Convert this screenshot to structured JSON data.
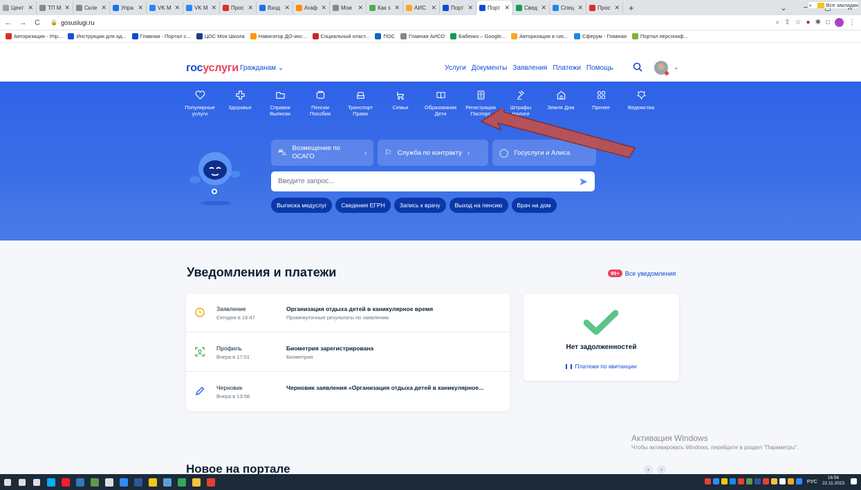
{
  "browser": {
    "tabs": [
      {
        "label": "Цент",
        "color": "#9aa0a6"
      },
      {
        "label": "ТП М",
        "color": "#888888"
      },
      {
        "label": "Скле",
        "color": "#888888"
      },
      {
        "label": "Упра",
        "color": "#1a73e8"
      },
      {
        "label": "VK М",
        "color": "#2787f5"
      },
      {
        "label": "VK М",
        "color": "#2787f5"
      },
      {
        "label": "Прос",
        "color": "#d93025"
      },
      {
        "label": "Вход",
        "color": "#1a73e8"
      },
      {
        "label": "Агаф",
        "color": "#ff8c00"
      },
      {
        "label": "Мои",
        "color": "#888888"
      },
      {
        "label": "Как з",
        "color": "#4caf50"
      },
      {
        "label": "АИС",
        "color": "#f9a825"
      },
      {
        "label": "Порт",
        "color": "#0d4cd3"
      },
      {
        "label": "Порт",
        "color": "#0d4cd3",
        "active": true
      },
      {
        "label": "Свед",
        "color": "#0f9d58"
      },
      {
        "label": "Спец",
        "color": "#1e88e5"
      },
      {
        "label": "Прос",
        "color": "#d93025"
      }
    ],
    "new_tab": "+",
    "url": "gosuslugi.ru",
    "bookmarks": [
      {
        "label": "Авторизация - Упр...",
        "color": "#d93025"
      },
      {
        "label": "Инструкции для ад...",
        "color": "#1a4fd8"
      },
      {
        "label": "Главная - Портал с...",
        "color": "#0d4cd3"
      },
      {
        "label": "ЦОС Моя Школа",
        "color": "#1e3a8a"
      },
      {
        "label": "Навигатор ДО-инс...",
        "color": "#ff9800"
      },
      {
        "label": "Социальный класт...",
        "color": "#c62828"
      },
      {
        "label": "ПОС",
        "color": "#1565c0"
      },
      {
        "label": "Главная АИСО",
        "color": "#888888"
      },
      {
        "label": "Бабенко – Google...",
        "color": "#0f9d58"
      },
      {
        "label": "Авторизация в сис...",
        "color": "#f9a825"
      },
      {
        "label": "Сферум - Главная",
        "color": "#1e88e5"
      },
      {
        "label": "Портал персониф...",
        "color": "#7cb342"
      }
    ],
    "bookmarks_more": "»",
    "all_bookmarks": "Все закладки"
  },
  "header": {
    "logo_part1": "гос",
    "logo_part2": "услуги",
    "audience": "Гражданам",
    "nav": [
      "Услуги",
      "Документы",
      "Заявления",
      "Платежи",
      "Помощь"
    ]
  },
  "categories": [
    {
      "label": "Популярные услуги",
      "icon": "heart-icon"
    },
    {
      "label": "Здоровье",
      "icon": "medical-cross-icon"
    },
    {
      "label": "Справки Выписки",
      "icon": "folder-icon"
    },
    {
      "label": "Пенсии Пособия",
      "icon": "wallet-icon"
    },
    {
      "label": "Транспорт Права",
      "icon": "car-icon"
    },
    {
      "label": "Семья",
      "icon": "stroller-icon"
    },
    {
      "label": "Образование Дети",
      "icon": "book-icon"
    },
    {
      "label": "Регистрация Паспорт",
      "icon": "passport-icon"
    },
    {
      "label": "Штрафы Налоги",
      "icon": "gavel-icon"
    },
    {
      "label": "Земля Дом",
      "icon": "house-icon"
    },
    {
      "label": "Прочее",
      "icon": "grid-icon"
    },
    {
      "label": "Ведомства",
      "icon": "emblem-icon"
    }
  ],
  "promos": [
    {
      "label": "Возмещение по ОСАГО",
      "icon": "car-outline-icon"
    },
    {
      "label": "Служба по контракту",
      "icon": "flag-icon"
    },
    {
      "label": "Госуслуги и Алиса",
      "icon": "alice-icon"
    }
  ],
  "search": {
    "placeholder": "Введите запрос..."
  },
  "quick_chips": [
    "Выписка медуслуг",
    "Сведения ЕГРН",
    "Запись к врачу",
    "Выход на пенсию",
    "Врач на дом"
  ],
  "notifications": {
    "title": "Уведомления и платежи",
    "badge": "99+",
    "all_link": "Все уведомления",
    "items": [
      {
        "type": "Заявление",
        "time": "Сегодня в 16:47",
        "title": "Организация отдыха детей в каникулярное время",
        "subtitle": "Промежуточные результаты по заявлению",
        "icon": "clock-icon"
      },
      {
        "type": "Профиль",
        "time": "Вчера в 17:01",
        "title": "Биометрия зарегистрирована",
        "subtitle": "Биометрия",
        "icon": "biometry-icon"
      },
      {
        "type": "Черновик",
        "time": "Вчера в 13:58",
        "title": "Черновик заявления «Организация отдыха детей в каникулярное...",
        "subtitle": "",
        "icon": "pencil-icon"
      }
    ]
  },
  "debt": {
    "title": "Нет задолженностей",
    "link": "Платежи по квитанции"
  },
  "activation": {
    "line1": "Активация Windows",
    "line2": "Чтобы активировать Windows, перейдите в раздел \"Параметры\"."
  },
  "new_on_portal": "Новое на портале",
  "taskbar": {
    "lang": "РУС",
    "time": "16:56",
    "date": "22.11.2023",
    "apps": [
      {
        "icon": "windows-start-icon",
        "color": "#ffffff"
      },
      {
        "icon": "search-icon",
        "color": "#ffffff"
      },
      {
        "icon": "task-view-icon",
        "color": "#ffffff"
      },
      {
        "icon": "skype-icon",
        "color": "#00aff0"
      },
      {
        "icon": "opera-icon",
        "color": "#ff1b2d"
      },
      {
        "icon": "edge-icon",
        "color": "#3277bc"
      },
      {
        "icon": "app-icon",
        "color": "#5c9a4a"
      },
      {
        "icon": "pen-app-icon",
        "color": "#dddddd"
      },
      {
        "icon": "zoom-icon",
        "color": "#2d8cff"
      },
      {
        "icon": "word-icon",
        "color": "#2b579a"
      },
      {
        "icon": "image-app-icon",
        "color": "#f2c811"
      },
      {
        "icon": "app2-icon",
        "color": "#5aa0d8"
      },
      {
        "icon": "chrome-icon",
        "color": "#34a853"
      },
      {
        "icon": "explorer-icon",
        "color": "#f9c23c"
      },
      {
        "icon": "chrome-profile-icon",
        "color": "#e34133"
      }
    ]
  }
}
